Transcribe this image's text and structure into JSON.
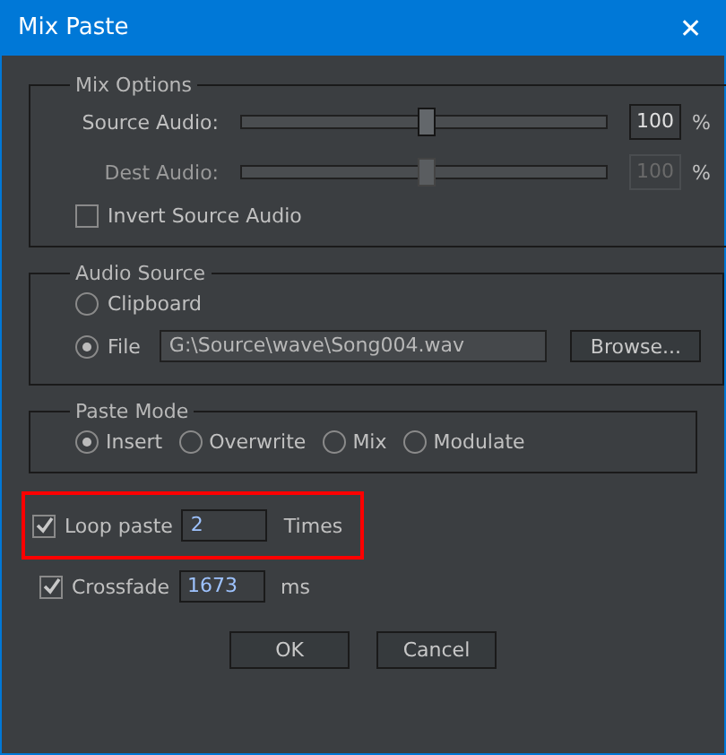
{
  "window": {
    "title": "Mix Paste",
    "close": "✕"
  },
  "mix_options": {
    "legend": "Mix Options",
    "sliders": [
      {
        "label": "Source Audio:",
        "level": 0.5,
        "value": "100",
        "unit": "%",
        "disabled": false
      },
      {
        "label": "Dest Audio:",
        "level": 0.5,
        "value": "100",
        "unit": "%",
        "disabled": true
      }
    ],
    "invert": {
      "label": "Invert Source Audio",
      "checked": false
    }
  },
  "audio_source": {
    "legend": "Audio Source",
    "options": [
      {
        "label": "Clipboard",
        "selected": false,
        "kind": "plain"
      },
      {
        "label": "File",
        "selected": true,
        "kind": "file",
        "path": "G:\\Source\\wave\\Song004.wav",
        "browse": "Browse..."
      }
    ]
  },
  "paste_mode": {
    "legend": "Paste Mode",
    "options": [
      {
        "label": "Insert",
        "selected": true
      },
      {
        "label": "Overwrite",
        "selected": false
      },
      {
        "label": "Mix",
        "selected": false
      },
      {
        "label": "Modulate",
        "selected": false
      }
    ]
  },
  "repeat_options": [
    {
      "label": "Loop paste",
      "checked": true,
      "value": "2",
      "unit": "Times",
      "highlighted": true
    },
    {
      "label": "Crossfade",
      "checked": true,
      "value": "1673",
      "unit": "ms",
      "highlighted": false
    }
  ],
  "buttons": [
    "OK",
    "Cancel"
  ]
}
